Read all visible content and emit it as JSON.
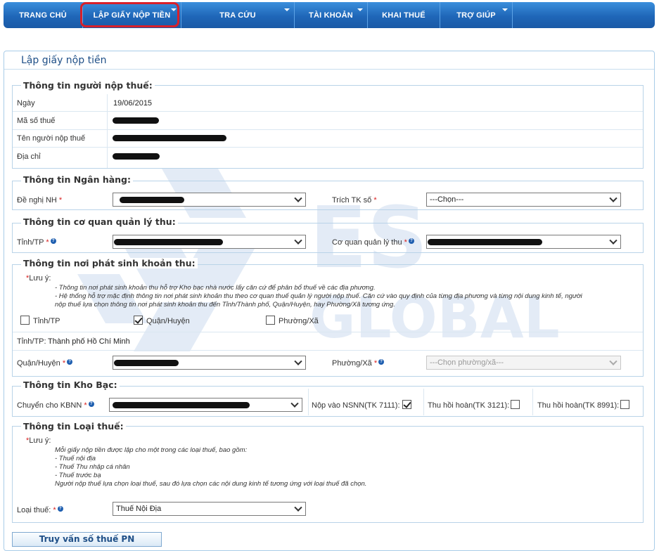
{
  "nav": {
    "items": [
      {
        "label": "TRANG CHỦ"
      },
      {
        "label": "LẬP GIẤY NỘP TIỀN"
      },
      {
        "label": "TRA CỨU"
      },
      {
        "label": "TÀI KHOẢN"
      },
      {
        "label": "KHAI THUẾ"
      },
      {
        "label": "TRỢ GIÚP"
      }
    ]
  },
  "panel": {
    "title": "Lập giấy nộp tiền"
  },
  "taxpayer": {
    "legend": "Thông tin người nộp thuế:",
    "date_label": "Ngày",
    "date_value": "19/06/2015",
    "tax_code_label": "Mã số thuế",
    "name_label": "Tên người nộp thuế",
    "address_label": "Địa chỉ"
  },
  "bank": {
    "legend": "Thông tin Ngân hàng:",
    "bank_label": "Đề nghị NH",
    "account_label": "Trích TK số",
    "account_value": "---Chọn---",
    "required_mark": "*"
  },
  "authority": {
    "legend": "Thông tin cơ quan quản lý thu:",
    "province_label": "Tỉnh/TP",
    "agency_label": "Cơ quan quản lý thu"
  },
  "origin": {
    "legend": "Thông tin nơi phát sinh khoản thu:",
    "note_title": "Lưu ý:",
    "note_line1": "- Thông tin nơi phát sinh khoản thu hỗ trợ Kho bạc nhà nước lấy căn cứ để phân bổ thuế về các địa phương.",
    "note_line2": "- Hệ thống hỗ trợ mặc định thông tin nơi phát sinh khoản thu theo cơ quan thuế quản lý người nộp thuế. Căn cứ vào quy định của từng địa phương và từng nội dung kinh tế, người",
    "note_line3": "nộp thuế lựa chọn thông tin nơi phát sinh khoản thu đến Tỉnh/Thành phố, Quận/Huyện, hay Phường/Xã tương ứng.",
    "opt_province": "Tỉnh/TP",
    "opt_district": "Quận/Huyện",
    "opt_ward": "Phường/Xã",
    "province_label": "Tỉnh/TP:",
    "province_value": "Thành phố Hồ Chí Minh",
    "district_label": "Quận/Huyện",
    "ward_label": "Phường/Xã",
    "ward_placeholder": "---Chọn phường/xã---"
  },
  "treasury": {
    "legend": "Thông tin Kho Bạc:",
    "transfer_label": "Chuyển cho KBNN",
    "nsnn_label": "Nộp vào NSNN(TK 7111):",
    "refund_3121_label": "Thu hồi hoàn(TK 3121):",
    "refund_8991_label": "Thu hồi hoàn(TK 8991):"
  },
  "taxtype": {
    "legend": "Thông tin Loại thuế:",
    "note_title": "Lưu ý:",
    "note_line1": "Mỗi giấy nộp tiền được lập cho một trong các loại thuế, bao gồm:",
    "note_line2": "- Thuế nội địa",
    "note_line3": "- Thuế Thu nhập cá nhân",
    "note_line4": "- Thuế trước bạ",
    "note_line5": "Người nộp thuế lựa chọn loại thuế, sau đó lựa chọn các nội dung kinh tế tương ứng với loại thuế đã chọn.",
    "type_label": "Loại thuế:",
    "type_value": "Thuế Nội Địa"
  },
  "query_button": "Truy vấn số thuế PN",
  "watermark": {
    "text_top": "ES",
    "text_bottom": "GLOBAL"
  },
  "colors": {
    "nav": "#1f66b8",
    "highlight": "#d8202a",
    "title": "#1f4f87"
  }
}
